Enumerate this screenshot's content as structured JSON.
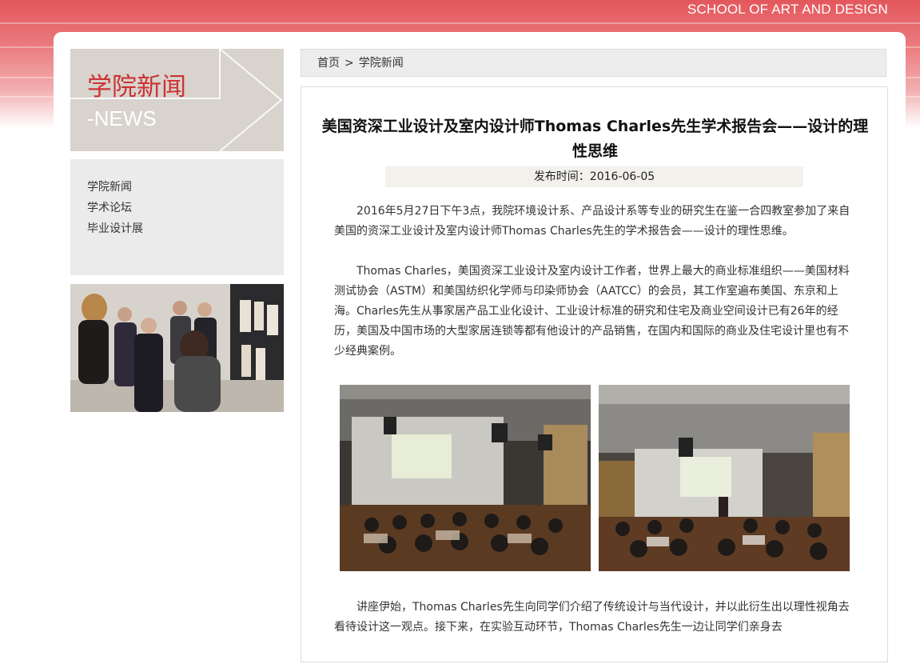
{
  "header": {
    "subtitle": "SCHOOL OF ART AND DESIGN"
  },
  "sidebar": {
    "banner_title": "学院新闻",
    "banner_subtitle": "-NEWS",
    "menu": [
      {
        "label": "学院新闻"
      },
      {
        "label": "学术论坛"
      },
      {
        "label": "毕业设计展"
      }
    ]
  },
  "breadcrumb": {
    "home": "首页",
    "separator": ">",
    "current": "学院新闻"
  },
  "article": {
    "title": "美国资深工业设计及室内设计师Thomas Charles先生学术报告会——设计的理性思维",
    "date_label": "发布时间：2016-06-05",
    "paragraphs": [
      "2016年5月27日下午3点，我院环境设计系、产品设计系等专业的研究生在鉴一合四教室参加了来自美国的资深工业设计及室内设计师Thomas Charles先生的学术报告会——设计的理性思维。",
      "Thomas Charles，美国资深工业设计及室内设计工作者，世界上最大的商业标准组织——美国材料测试协会（ASTM）和美国纺织化学师与印染师协会（AATCC）的会员，其工作室遍布美国、东京和上海。Charles先生从事家居产品工业化设计、工业设计标准的研究和住宅及商业空间设计已有26年的经历，美国及中国市场的大型家居连锁等都有他设计的产品销售，在国内和国际的商业及住宅设计里也有不少经典案例。",
      "讲座伊始，Thomas Charles先生向同学们介绍了传统设计与当代设计，并以此衍生出以理性视角去看待设计这一观点。接下来，在实验互动环节，Thomas Charles先生一边让同学们亲身去"
    ]
  },
  "colors": {
    "accent_red": "#cc3333",
    "banner_bg": "#d8d3cd",
    "menu_bg": "#ebebeb"
  }
}
